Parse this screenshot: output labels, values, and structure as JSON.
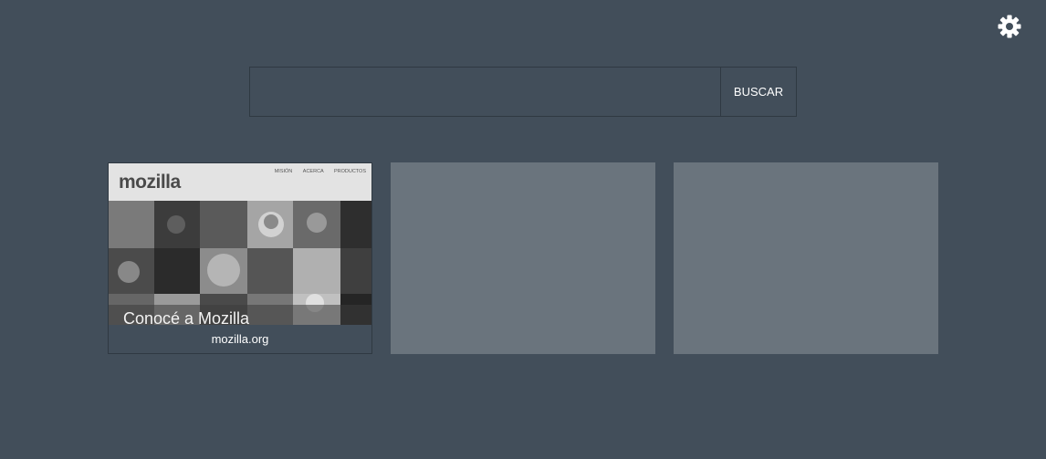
{
  "settings": {
    "icon": "gear-icon"
  },
  "search": {
    "value": "",
    "placeholder": "",
    "button_label": "BUSCAR"
  },
  "tiles": [
    {
      "label": "mozilla.org",
      "thumbnail": {
        "logo": "mozilla",
        "nav": [
          "MISIÓN",
          "ACERCA",
          "PRODUCTOS"
        ],
        "caption": "Conocé a Mozilla"
      }
    },
    {
      "label": ""
    },
    {
      "label": ""
    }
  ],
  "colors": {
    "background": "#424e5a",
    "empty_tile": "#6a747d",
    "border": "#2f3942",
    "text": "#ffffff"
  }
}
